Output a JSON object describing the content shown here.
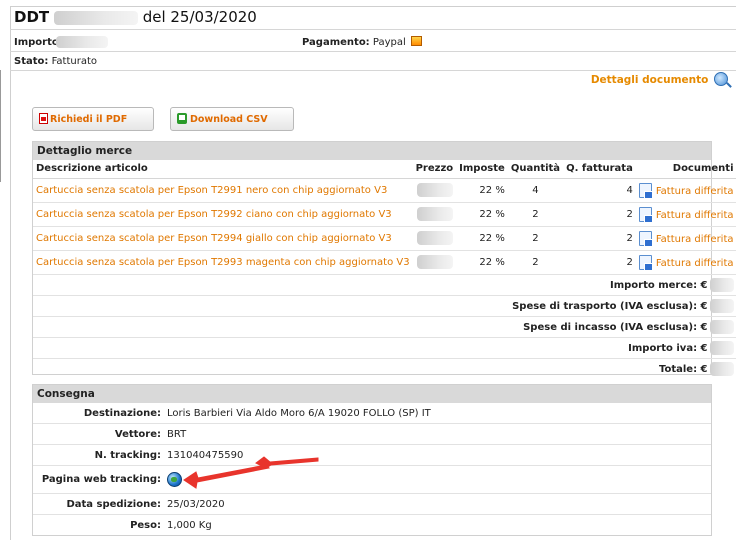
{
  "header": {
    "ddt_label": "DDT",
    "date_text": "del 25/03/2020",
    "importo_label": "Importo",
    "pagamento_label": "Pagamento:",
    "pagamento_value": "Paypal",
    "stato_label": "Stato:",
    "stato_value": "Fatturato"
  },
  "links": {
    "dettagli_documento": "Dettagli documento"
  },
  "buttons": {
    "pdf": "Richiedi il PDF",
    "csv": "Download CSV"
  },
  "merce": {
    "title": "Dettaglio merce",
    "columns": [
      "Descrizione articolo",
      "Prezzo",
      "Imposte",
      "Quantità",
      "Q. fatturata",
      "Documenti"
    ],
    "rows": [
      {
        "descrizione": "Cartuccia senza scatola per Epson T2991 nero con chip aggiornato V3",
        "imposte": "22 %",
        "quantita": "4",
        "q_fatturata": "4",
        "documento": "Fattura differita"
      },
      {
        "descrizione": "Cartuccia senza scatola per Epson T2992 ciano con chip aggiornato V3",
        "imposte": "22 %",
        "quantita": "2",
        "q_fatturata": "2",
        "documento": "Fattura differita"
      },
      {
        "descrizione": "Cartuccia senza scatola per Epson T2994 giallo con chip aggiornato V3",
        "imposte": "22 %",
        "quantita": "2",
        "q_fatturata": "2",
        "documento": "Fattura differita"
      },
      {
        "descrizione": "Cartuccia senza scatola per Epson T2993 magenta con chip aggiornato V3",
        "imposte": "22 %",
        "quantita": "2",
        "q_fatturata": "2",
        "documento": "Fattura differita"
      }
    ],
    "totals": [
      {
        "label": "Importo merce: €"
      },
      {
        "label": "Spese di trasporto (IVA esclusa): €"
      },
      {
        "label": "Spese di incasso (IVA esclusa): €"
      },
      {
        "label": "Importo iva: €"
      },
      {
        "label": "Totale: €"
      }
    ]
  },
  "consegna": {
    "title": "Consegna",
    "destinazione_label": "Destinazione:",
    "destinazione_value": "Loris Barbieri Via Aldo Moro 6/A 19020 FOLLO (SP) IT",
    "vettore_label": "Vettore:",
    "vettore_value": "BRT",
    "tracking_label": "N. tracking:",
    "tracking_value": "131040475590",
    "web_tracking_label": "Pagina web tracking:",
    "data_spedizione_label": "Data spedizione:",
    "data_spedizione_value": "25/03/2020",
    "peso_label": "Peso:",
    "peso_value": "1,000 Kg"
  },
  "colors": {
    "accent_orange": "#e07800",
    "annotation_red": "#e8342c",
    "panel_header": "#d9d9d9"
  },
  "icons": [
    "paypal-icon",
    "magnifier-icon",
    "pdf-icon",
    "csv-icon",
    "document-icon",
    "globe-icon"
  ]
}
